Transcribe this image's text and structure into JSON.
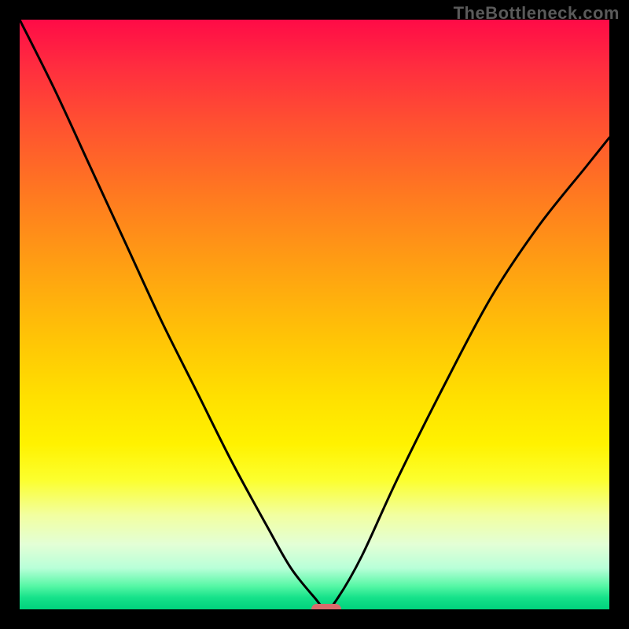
{
  "watermark": "TheBottleneck.com",
  "chart_data": {
    "type": "line",
    "title": "",
    "xlabel": "",
    "ylabel": "",
    "xlim": [
      0,
      100
    ],
    "ylim": [
      0,
      100
    ],
    "series": [
      {
        "name": "bottleneck-curve",
        "x": [
          0,
          6,
          12,
          18,
          24,
          30,
          36,
          42,
          46,
          50,
          52,
          54,
          58,
          64,
          72,
          80,
          88,
          96,
          100
        ],
        "values": [
          100,
          88,
          75,
          62,
          49,
          37,
          25,
          14,
          7,
          2,
          0,
          2,
          9,
          22,
          38,
          53,
          65,
          75,
          80
        ]
      }
    ],
    "minimum_marker": {
      "x": 52,
      "y": 0
    },
    "background_gradient_stops": [
      {
        "pct": 0,
        "color": "#ff0b47"
      },
      {
        "pct": 50,
        "color": "#ffe000"
      },
      {
        "pct": 100,
        "color": "#00d37d"
      }
    ],
    "legend": false,
    "grid": false
  }
}
